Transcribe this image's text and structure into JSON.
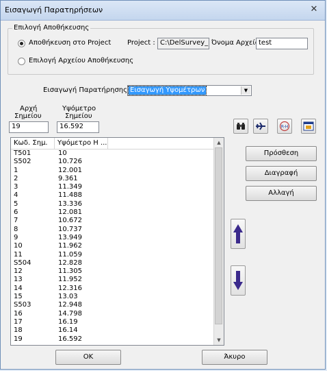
{
  "window": {
    "title": "Εισαγωγή Παρατηρήσεων",
    "close_glyph": "✕"
  },
  "storage": {
    "group_label": "Επιλογή Αποθήκευσης",
    "option_project": "Αποθήκευση στο Project",
    "option_project_selected": true,
    "project_label": "Project :",
    "project_value": "C:\\DelSurvey_Pr",
    "filename_label": "Όνομα Αρχείου(.txt)",
    "filename_value": "test",
    "option_file": "Επιλογή Αρχείου Αποθήκευσης",
    "option_file_selected": false
  },
  "observation": {
    "label": "Εισαγωγή Παρατήρησης:",
    "selected": "Εισαγωγή Υψομέτρων"
  },
  "inputs": {
    "point_label_1": "Αρχή",
    "point_label_2": "Σημείου",
    "point_value": "19",
    "height_label_1": "Υψόμετρο",
    "height_label_2": "Σημείου",
    "height_value": "16.592"
  },
  "toolbar_icons": [
    "binoculars-icon",
    "plane-icon",
    "rh-circle-icon",
    "table-window-icon"
  ],
  "list": {
    "columns": [
      "Κωδ. Σημ.",
      "Υψόμετρο Η ..."
    ],
    "rows": [
      [
        "T501",
        "10"
      ],
      [
        "S502",
        "10.726"
      ],
      [
        "1",
        "12.001"
      ],
      [
        "2",
        "9.361"
      ],
      [
        "3",
        "11.349"
      ],
      [
        "4",
        "11.488"
      ],
      [
        "5",
        "13.336"
      ],
      [
        "6",
        "12.081"
      ],
      [
        "7",
        "10.672"
      ],
      [
        "8",
        "10.737"
      ],
      [
        "9",
        "13.949"
      ],
      [
        "10",
        "11.962"
      ],
      [
        "11",
        "11.059"
      ],
      [
        "S504",
        "12.828"
      ],
      [
        "12",
        "11.305"
      ],
      [
        "13",
        "11.952"
      ],
      [
        "14",
        "12.316"
      ],
      [
        "15",
        "13.03"
      ],
      [
        "S503",
        "12.948"
      ],
      [
        "16",
        "14.798"
      ],
      [
        "17",
        "16.19"
      ],
      [
        "18",
        "16.14"
      ],
      [
        "19",
        "16.592"
      ]
    ]
  },
  "buttons": {
    "add": "Πρόσθεση",
    "delete": "Διαγραφή",
    "change": "Αλλαγή",
    "ok": "OK",
    "cancel": "Άκυρο"
  },
  "colors": {
    "accent": "#3399ff",
    "arrow": "#3b2a8c"
  }
}
